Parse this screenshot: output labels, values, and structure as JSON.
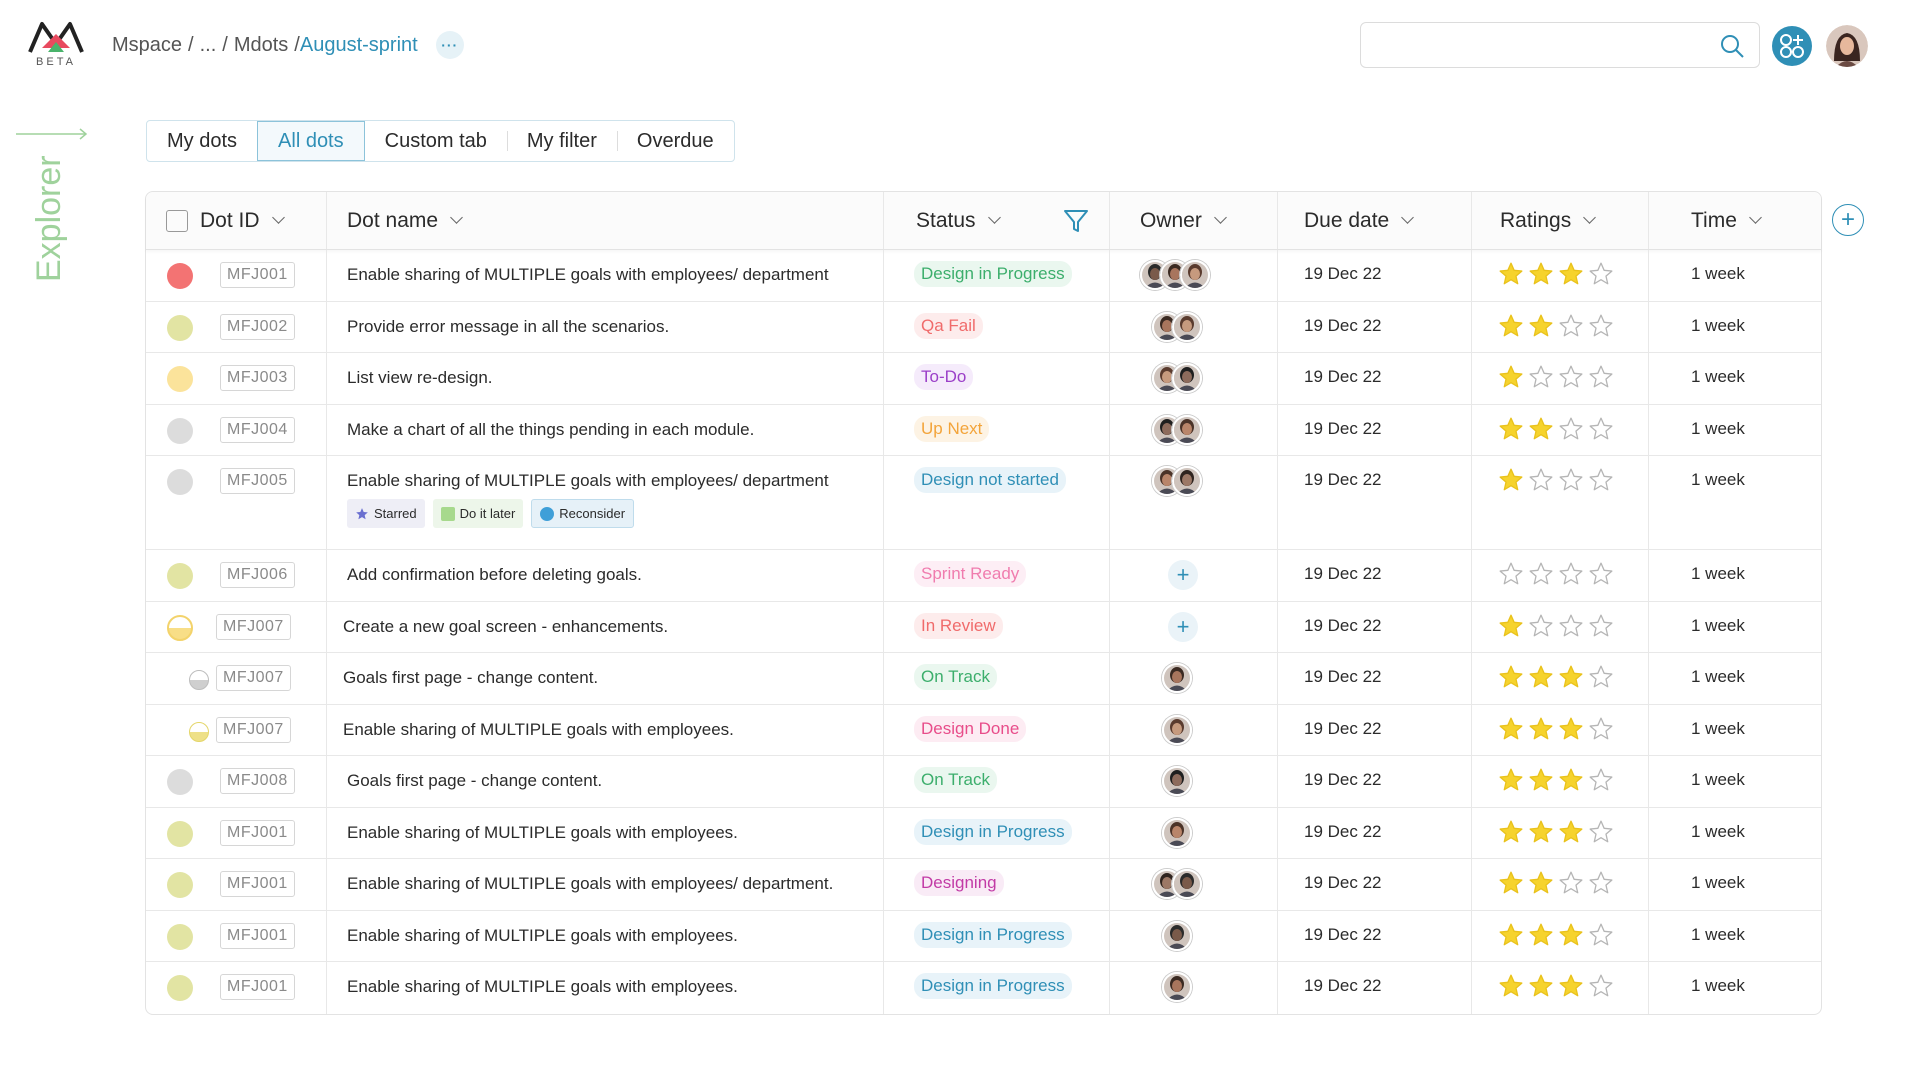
{
  "app": {
    "logo_text": "BETA"
  },
  "breadcrumb": {
    "root": "Mspace",
    "ellipsis": "...",
    "parent": "Mdots",
    "current": "August-sprint",
    "more_label": "···"
  },
  "search": {
    "placeholder": "",
    "value": ""
  },
  "sidebar": {
    "explorer_label": "Explorer"
  },
  "tabs": [
    "My dots",
    "All dots",
    "Custom tab",
    "My filter",
    "Overdue"
  ],
  "active_tab": "All dots",
  "table": {
    "headers": {
      "dot_id": "Dot ID",
      "dot_name": "Dot name",
      "status": "Status",
      "owner": "Owner",
      "due_date": "Due date",
      "ratings": "Ratings",
      "time": "Time"
    },
    "rows": [
      {
        "indicator_color": "#f37373",
        "id": "MFJ001",
        "name": "Enable sharing of MULTIPLE goals with employees/ department",
        "status": "Design in Progress",
        "status_color": "#3cae6c",
        "status_bg": "#eaf7ef",
        "owners": 3,
        "due": "19 Dec 22",
        "rating": 3,
        "time": "1 week"
      },
      {
        "indicator_color": "#e2e4a3",
        "id": "MFJ002",
        "name": "Provide error message in all the scenarios.",
        "status": "Qa Fail",
        "status_color": "#f06b6b",
        "status_bg": "#fdecec",
        "owners": 2,
        "due": "19 Dec 22",
        "rating": 2,
        "time": "1 week"
      },
      {
        "indicator_color": "#fbe39b",
        "id": "MFJ003",
        "name": "List view re-design.",
        "status": "To-Do",
        "status_color": "#9b3fc8",
        "status_bg": "#f5ebfb",
        "owners": 2,
        "due": "19 Dec 22",
        "rating": 1,
        "time": "1 week"
      },
      {
        "indicator_color": "#dcdcdc",
        "id": "MFJ004",
        "name": "Make a chart of all the things pending in each module.",
        "status": "Up Next",
        "status_color": "#f3a43a",
        "status_bg": "#fdf3e4",
        "owners": 2,
        "due": "19 Dec 22",
        "rating": 2,
        "time": "1 week"
      },
      {
        "indicator_color": "#dcdcdc",
        "id": "MFJ005",
        "name": "Enable sharing of MULTIPLE goals with employees/ department",
        "status": "Design not started",
        "status_color": "#2f8fb6",
        "status_bg": "#e8f3f9",
        "owners": 2,
        "due": "19 Dec 22",
        "rating": 1,
        "time": "1 week",
        "tags": [
          "Starred",
          "Do it later",
          "Reconsider"
        ]
      },
      {
        "indicator_color": "#e2e4a3",
        "id": "MFJ006",
        "name": "Add confirmation before deleting goals.",
        "status": "Sprint Ready",
        "status_color": "#f07cae",
        "status_bg": "#fdeef5",
        "owners": 0,
        "due": "19 Dec 22",
        "rating": 0,
        "time": "1 week"
      },
      {
        "indicator_color": "half",
        "id": "MFJ007",
        "name": "Create a new goal screen - enhancements.",
        "status": "In Review",
        "status_color": "#f06b6b",
        "status_bg": "#fdecec",
        "owners": 0,
        "due": "19 Dec 22",
        "rating": 1,
        "time": "1 week"
      },
      {
        "indicator_color": "small-gray",
        "id": "MFJ007",
        "name": "Goals first page - change content.",
        "status": "On Track",
        "status_color": "#3cae6c",
        "status_bg": "#eaf7ef",
        "owners": 1,
        "due": "19 Dec 22",
        "rating": 3,
        "time": "1 week"
      },
      {
        "indicator_color": "small-yellow",
        "id": "MFJ007",
        "name": "Enable sharing of MULTIPLE goals with employees.",
        "status": "Design Done",
        "status_color": "#e84d8a",
        "status_bg": "#fdecf3",
        "owners": 1,
        "due": "19 Dec 22",
        "rating": 3,
        "time": "1 week"
      },
      {
        "indicator_color": "#dcdcdc",
        "id": "MFJ008",
        "name": "Goals first page - change content.",
        "status": "On Track",
        "status_color": "#3cae6c",
        "status_bg": "#eaf7ef",
        "owners": 1,
        "due": "19 Dec 22",
        "rating": 3,
        "time": "1 week"
      },
      {
        "indicator_color": "#e2e4a3",
        "id": "MFJ001",
        "name": "Enable sharing of MULTIPLE goals with employees.",
        "status": "Design in Progress",
        "status_color": "#2f8fb6",
        "status_bg": "#e8f3f9",
        "owners": 1,
        "due": "19 Dec 22",
        "rating": 3,
        "time": "1 week"
      },
      {
        "indicator_color": "#e2e4a3",
        "id": "MFJ001",
        "name": "Enable sharing of MULTIPLE goals with employees/ department.",
        "status": "Designing",
        "status_color": "#c23ba6",
        "status_bg": "#f9ebf6",
        "owners": 2,
        "due": "19 Dec 22",
        "rating": 2,
        "time": "1 week"
      },
      {
        "indicator_color": "#e2e4a3",
        "id": "MFJ001",
        "name": "Enable sharing of MULTIPLE goals with employees.",
        "status": "Design in Progress",
        "status_color": "#2f8fb6",
        "status_bg": "#e8f3f9",
        "owners": 1,
        "due": "19 Dec 22",
        "rating": 3,
        "time": "1 week"
      },
      {
        "indicator_color": "#e2e4a3",
        "id": "MFJ001",
        "name": "Enable sharing of MULTIPLE goals with employees.",
        "status": "Design in Progress",
        "status_color": "#2f8fb6",
        "status_bg": "#e8f3f9",
        "owners": 1,
        "due": "19 Dec 22",
        "rating": 3,
        "time": "1 week"
      }
    ]
  },
  "colors": {
    "accent": "#2f8fb6",
    "star": "#f6d32d",
    "explorer": "#9fd29c"
  }
}
